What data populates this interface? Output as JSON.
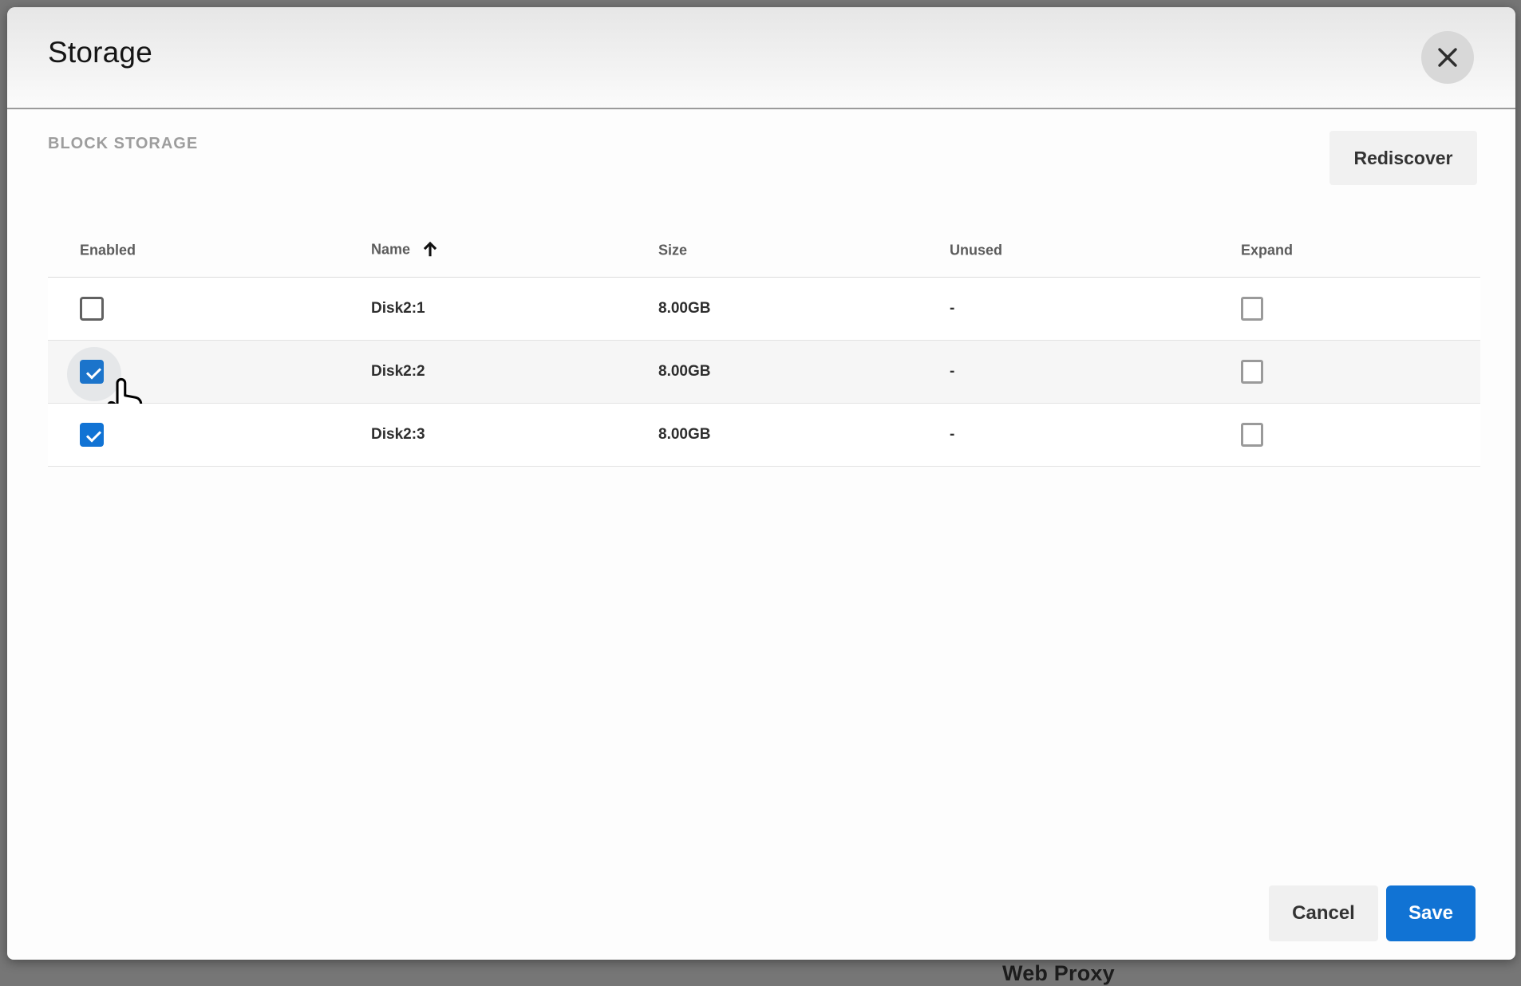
{
  "modal": {
    "title": "Storage",
    "section_label": "BLOCK STORAGE",
    "rediscover_label": "Rediscover",
    "footer": {
      "cancel_label": "Cancel",
      "save_label": "Save"
    }
  },
  "table": {
    "columns": [
      {
        "label": "Enabled"
      },
      {
        "label": "Name",
        "sorted": "ascending"
      },
      {
        "label": "Size"
      },
      {
        "label": "Unused"
      },
      {
        "label": "Expand"
      }
    ],
    "rows": [
      {
        "enabled": false,
        "name": "Disk2:1",
        "size": "8.00GB",
        "unused": "-",
        "expand": false
      },
      {
        "enabled": true,
        "name": "Disk2:2",
        "size": "8.00GB",
        "unused": "-",
        "expand": false,
        "cursor": "hand-pointer-over-checkbox"
      },
      {
        "enabled": true,
        "name": "Disk2:3",
        "size": "8.00GB",
        "unused": "-",
        "expand": false
      }
    ]
  },
  "background": {
    "partial_text": "Web Proxy"
  },
  "colors": {
    "accent_blue": "#1173d4",
    "overlay_gray": "#767676",
    "row_alt": "#f6f6f6"
  }
}
